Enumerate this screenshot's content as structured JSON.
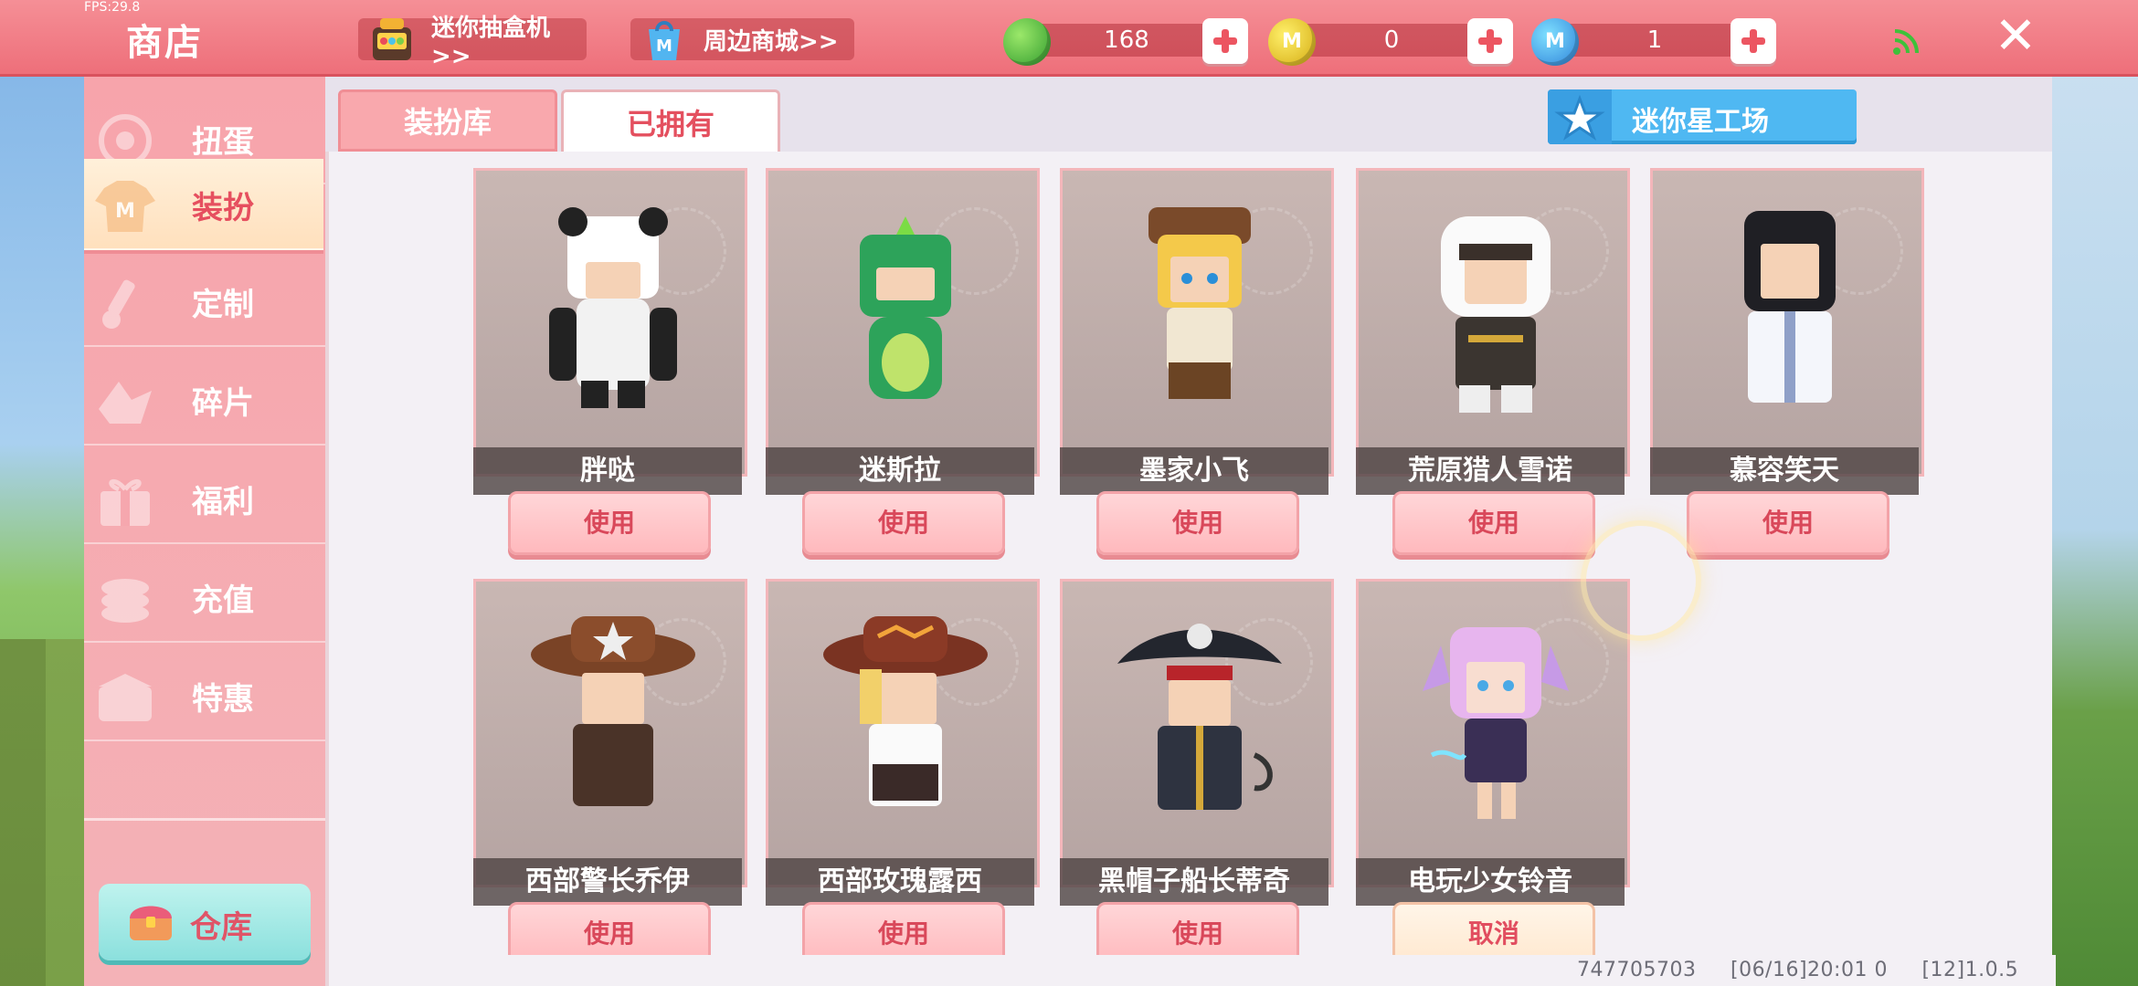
{
  "status": {
    "fps": "FPS:29.8"
  },
  "topbar": {
    "title": "商店",
    "links": [
      {
        "label": "迷你抽盒机>>",
        "icon": "gacha-machine-icon"
      },
      {
        "label": "周边商城>>",
        "icon": "shopping-bag-icon"
      }
    ],
    "currencies": [
      {
        "icon": "green-gem-icon",
        "value": "168",
        "color": "#3aa833"
      },
      {
        "icon": "gold-coin-icon",
        "value": "0",
        "color": "#e1b616"
      },
      {
        "icon": "blue-coin-icon",
        "value": "1",
        "color": "#2b8ee0"
      }
    ]
  },
  "sidebar": {
    "items": [
      {
        "label": "扭蛋",
        "icon": "gacha-egg-icon",
        "active": false
      },
      {
        "label": "装扮",
        "icon": "tshirt-icon",
        "active": true
      },
      {
        "label": "定制",
        "icon": "brush-icon",
        "active": false
      },
      {
        "label": "碎片",
        "icon": "fragment-icon",
        "active": false
      },
      {
        "label": "福利",
        "icon": "gift-icon",
        "active": false
      },
      {
        "label": "充值",
        "icon": "coin-stack-icon",
        "active": false
      },
      {
        "label": "特惠",
        "icon": "discount-box-icon",
        "active": false
      }
    ],
    "warehouse_label": "仓库"
  },
  "tabs": [
    {
      "label": "装扮库",
      "active": false
    },
    {
      "label": "已拥有",
      "active": true
    }
  ],
  "workshop_label": "迷你星工场",
  "items": [
    {
      "name": "胖哒",
      "button": "使用"
    },
    {
      "name": "迷斯拉",
      "button": "使用"
    },
    {
      "name": "墨家小飞",
      "button": "使用"
    },
    {
      "name": "荒原猎人雪诺",
      "button": "使用"
    },
    {
      "name": "慕容笑天",
      "button": "使用"
    },
    {
      "name": "西部警长乔伊",
      "button": "使用"
    },
    {
      "name": "西部玫瑰露西",
      "button": "使用"
    },
    {
      "name": "黑帽子船长蒂奇",
      "button": "使用"
    },
    {
      "name": "电玩少女铃音",
      "button": "取消"
    }
  ],
  "footer": {
    "uid": "747705703",
    "time": "[06/16]20:01 0",
    "version": "[12]1.0.5"
  }
}
